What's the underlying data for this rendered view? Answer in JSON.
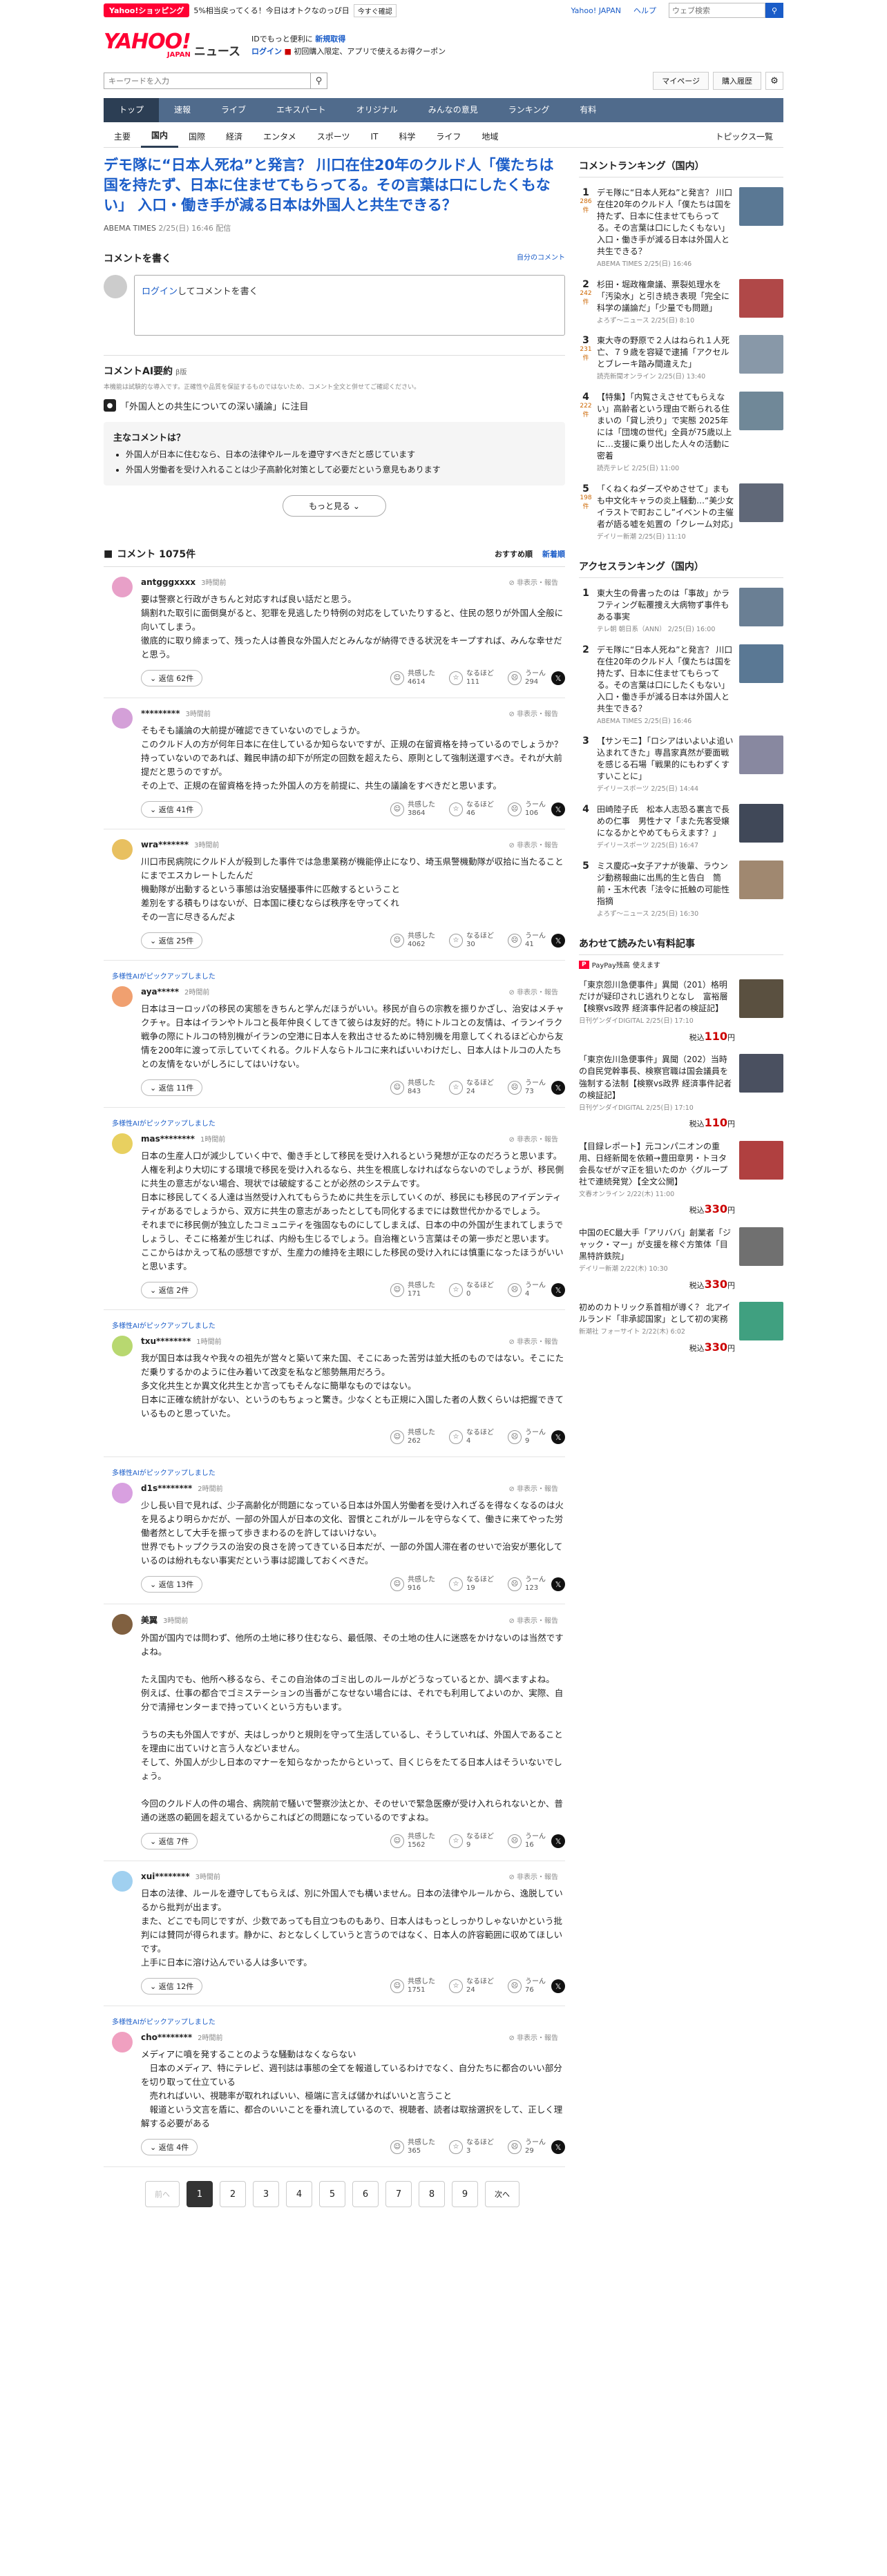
{
  "topbar": {
    "shop": "Yahoo!ショッピング",
    "promo": "5%相当戻ってくる！今日はオトクなのっぴ日",
    "promo_badge": "今すぐ確認",
    "links": [
      "Yahoo! JAPAN",
      "ヘルプ"
    ],
    "search_placeholder": "ウェブ検索"
  },
  "header": {
    "logo": "YAHOO!",
    "logo_sub": "JAPAN",
    "service": "ニュース",
    "promo_line1_pre": "IDでもっと便利に",
    "promo_line1_link": "新規取得",
    "promo_line2_link": "ログイン",
    "promo_line2_post": "初回購入限定、アプリで使えるお得クーポン"
  },
  "search": {
    "placeholder": "キーワードを入力",
    "mypage": "マイページ",
    "history": "購入履歴"
  },
  "nav": [
    "トップ",
    "速報",
    "ライブ",
    "エキスパート",
    "オリジナル",
    "みんなの意見",
    "ランキング",
    "有料"
  ],
  "subnav": [
    "主要",
    "国内",
    "国際",
    "経済",
    "エンタメ",
    "スポーツ",
    "IT",
    "科学",
    "ライフ",
    "地域"
  ],
  "subnav_more": "トピックス一覧",
  "article": {
    "title": "デモ隊に“日本人死ね”と発言？ 川口在住20年のクルド人「僕たちは国を持たず、日本に住ませてもらってる。その言葉は口にしたくもない」 入口・働き手が減る日本は外国人と共生できる？",
    "source": "ABEMA TIMES",
    "time": "2/25(日) 16:46 配信"
  },
  "comment_form": {
    "heading": "コメントを書く",
    "link": "自分のコメント",
    "login": "ログイン",
    "prompt": "してコメントを書く"
  },
  "ai": {
    "heading": "コメントAI要約",
    "beta": "β版",
    "note": "本機能は試験的な導入です。正確性や品質を保証するものではないため、コメント全文と併せてご確認ください。",
    "topic": "「外国人との共生についての深い議論」に注目",
    "main_title": "主なコメントは？",
    "points": [
      "外国人が日本に住むなら、日本の法律やルールを遵守すべきだと感じています",
      "外国人労働者を受け入れることは少子高齢化対策として必要だという意見もあります"
    ],
    "more": "もっと見る"
  },
  "comments_header": {
    "title": "コメント 1075件",
    "sort_recommended": "おすすめ順",
    "sort_new": "新着順"
  },
  "comment_labels": {
    "flag": "非表示・報告",
    "pick": "多様性AIがピックアップしました",
    "r1": "共感した",
    "r2": "なるほど",
    "r3": "うーん"
  },
  "comments": [
    {
      "user": "antgggxxxx",
      "ago": "3時間前",
      "pick": false,
      "color": "#e8a0c8",
      "text": "要は警察と行政がきちんと対応すれば良い話だと思う。\n鍋割れた取引に面倒臭がると、犯罪を見逃したり特例の対応をしていたりすると、住民の怒りが外国人全般に向いてしまう。\n徹底的に取り締まって、残った人は善良な外国人だとみんなが納得できる状況をキープすれば、みんな幸せだと思う。",
      "replies": "返信 62件",
      "r1": "4614",
      "r2": "111",
      "r3": "294"
    },
    {
      "user": "*********",
      "ago": "3時間前",
      "pick": false,
      "color": "#d4a0d8",
      "text": "そもそも議論の大前提が確認できていないのでしょうか。\nこのクルド人の方が何年日本に在住しているか知らないですが、正規の在留資格を持っているのでしょうか？\n持っていないのであれば、難民申請の却下が所定の回数を超えたら、原則として強制送還すべき。それが大前提だと思うのですが。\nその上で、正規の在留資格を持った外国人の方を前提に、共生の議論をすべきだと思います。",
      "replies": "返信 41件",
      "r1": "3864",
      "r2": "46",
      "r3": "106"
    },
    {
      "user": "wra*******",
      "ago": "3時間前",
      "pick": false,
      "color": "#e8c060",
      "text": "川口市民病院にクルド人が殺到した事件では急患業務が機能停止になり、埼玉県警機動隊が収拾に当たることにまでエスカレートしたんだ\n機動隊が出動するという事態は治安騒擾事件に匹敵するということ\n差別をする積もりはないが、日本国に棲むならば秩序を守ってくれ\nその一言に尽きるんだよ",
      "replies": "返信 25件",
      "r1": "4062",
      "r2": "30",
      "r3": "41"
    },
    {
      "user": "aya*****",
      "ago": "2時間前",
      "pick": true,
      "color": "#f0a070",
      "text": "日本はヨーロッパの移民の実態をきちんと学んだほうがいい。移民が自らの宗教を振りかざし、治安はメチャクチャ。日本はイランやトルコと長年仲良くしてきて彼らは友好的だ。特にトルコとの友情は、イランイラク戦争の際にトルコの特別機がイランの空港に日本人を救出させるために特別機を用意してくれるほど心から友情を200年に渡って示していてくれる。クルド人ならトルコに来ればいいわけだし、日本人はトルコの人たちとの友情をないがしろにしてはいけない。",
      "replies": "返信 11件",
      "r1": "843",
      "r2": "24",
      "r3": "73"
    },
    {
      "user": "mas********",
      "ago": "1時間前",
      "pick": true,
      "color": "#e8d060",
      "text": "日本の生産人口が減少していく中で、働き手として移民を受け入れるという発想が正なのだろうと思います。人権を利より大切にする環境で移民を受け入れるなら、共生を根底しなければならないのでしょうが、移民側に共生の意志がない場合、現状では破綻することが必然のシステムです。\n日本に移民してくる人達は当然受け入れてもらうために共生を示していくのが、移民にも移民のアイデンティティがあるでしょうから、双方に共生の意志があったとしても同化するまでには数世代かかるでしょう。\nそれまでに移民側が独立したコミュニティを強固なものにしてしまえば、日本の中の外国が生まれてしまうでしょうし、そこに格差が生じれば、内紛も生じるでしょう。自治権という言葉はその第一歩だと思います。\nここからはかえって私の感想ですが、生産力の維持を主眼にした移民の受け入れには慎重になったほうがいいと思います。",
      "replies": "返信 2件",
      "r1": "171",
      "r2": "0",
      "r3": "4"
    },
    {
      "user": "txu********",
      "ago": "1時間前",
      "pick": true,
      "color": "#b8d870",
      "text": "我が国日本は我々や我々の祖先が営々と築いて来た国、そこにあった苦労は並大抵のものではない。そこにただ乗りするかのように住み着いて改変を私など態勢無用だろう。\n多文化共生とか異文化共生とか言ってもそんなに簡単なものではない。\n日本に正確な統計がない、というのもちょっと驚き。少なくとも正規に入国した者の人数くらいは把握できているものと思っていた。",
      "replies": "",
      "r1": "262",
      "r2": "4",
      "r3": "9"
    },
    {
      "user": "d1s********",
      "ago": "2時間前",
      "pick": true,
      "color": "#d8a0e0",
      "text": "少し長い目で見れば、少子高齢化が問題になっている日本は外国人労働者を受け入れざるを得なくなるのは火を見るより明らかだが、一部の外国人が日本の文化、習慣とこれがルールを守らなくて、働きに来てやった労働者然として大手を振って歩きまわるのを許してはいけない。\n世界でもトップクラスの治安の良さを誇ってきている日本だが、一部の外国人滞在者のせいで治安が悪化しているのは紛れもない事実だという事は認識しておくべきだ。",
      "replies": "返信 13件",
      "r1": "916",
      "r2": "19",
      "r3": "123"
    },
    {
      "user": "美翼",
      "ago": "3時間前",
      "pick": false,
      "color": "#806040",
      "text": "外国が国内では問わず、他所の土地に移り住むなら、最低限、その土地の住人に迷惑をかけないのは当然ですよね。\n\nたえ国内でも、他所へ移るなら、そこの自治体のゴミ出しのルールがどうなっているとか、調べますよね。\n例えば、仕事の都合でゴミステーションの当番がこなせない場合には、それでも利用してよいのか、実際、自分で清掃センターまで持っていくという方もいます。\n\nうちの夫も外国人ですが、夫はしっかりと規則を守って生活しているし、そうしていれば、外国人であることを理由に出ていけと言う人などいません。\nそして、外国人が少し日本のマナーを知らなかったからといって、目くじらをたてる日本人はそういないでしょう。\n\n今回のクルド人の件の場合、病院前で騒いで警察沙汰とか、そのせいで緊急医療が受け入れられないとか、普通の迷惑の範囲を超えているからこればどの問題になっているのですよね。",
      "replies": "返信 7件",
      "r1": "1562",
      "r2": "9",
      "r3": "16"
    },
    {
      "user": "xui********",
      "ago": "3時間前",
      "pick": false,
      "color": "#a0d0f0",
      "text": "日本の法律、ルールを遵守してもらえば、別に外国人でも構いません。日本の法律やルールから、逸脱しているから批判が出ます。\nまた、どこでも同じですが、少数であっても目立つものもあり、日本人はもっとしっかりしゃないかという批判には賛同が得られます。静かに、おとなしくしていうと言うのではなく、日本人の許容範囲に収めてほしいです。\n上手に日本に溶け込んでいる人は多いです。",
      "replies": "返信 12件",
      "r1": "1751",
      "r2": "24",
      "r3": "76"
    },
    {
      "user": "cho********",
      "ago": "2時間前",
      "pick": true,
      "color": "#f0a0c0",
      "text": "メディアに噴を発することのような騒動はなくならない\n　日本のメディア、特にテレビ、週刊誌は事態の全てを報道しているわけでなく、自分たちに都合のいい部分を切り取って仕立ている\n　売れればいい、視聴率が取れればいい、極端に言えば儲かればいいと言うこと\n　報道という文言を盾に、都合のいいことを垂れ流しているので、視聴者、読者は取捨選択をして、正しく理解する必要がある",
      "replies": "返信 4件",
      "r1": "365",
      "r2": "3",
      "r3": "29"
    }
  ],
  "pager": {
    "prev": "前へ",
    "pages": [
      "1",
      "2",
      "3",
      "4",
      "5",
      "6",
      "7",
      "8",
      "9"
    ],
    "next": "次へ"
  },
  "side": {
    "ranking_title": "コメントランキング（国内）",
    "ranking": [
      {
        "rank": "1",
        "count": "286",
        "unit": "件",
        "title": "デモ隊に“日本人死ね”と発言？ 川口在住20年のクルド人「僕たちは国を持たず、日本に住ませてもらってる。その言葉は口にしたくもない」 入口・働き手が減る日本は外国人と共生できる？",
        "meta": "ABEMA TIMES 2/25(日) 16:46",
        "color": "#5a7894"
      },
      {
        "rank": "2",
        "count": "242",
        "unit": "件",
        "title": "杉田・堀政権衆議、票裂処理水を「汚染水」と引き続き表現「完全に科学の議論だ」「少量でも問題」",
        "meta": "よろず〜ニュース 2/25(日) 8:10",
        "color": "#b04848"
      },
      {
        "rank": "3",
        "count": "231",
        "unit": "件",
        "title": "東大寺の野原で２人はねられ１人死亡、７９歳を容疑で逮捕「アクセルとブレーキ踏み間違えた」",
        "meta": "読売新聞オンライン 2/25(日) 13:40",
        "color": "#8898a8"
      },
      {
        "rank": "4",
        "count": "222",
        "unit": "件",
        "title": "【特集】「内覧さえさせてもらえない」高齢者という理由で断られる住まいの「貸し渋り」で実態 2025年には「団塊の世代」全員が75歳以上に…支援に乗り出した人々の活動に密着",
        "meta": "読売テレビ 2/25(日) 11:00",
        "color": "#708898"
      },
      {
        "rank": "5",
        "count": "198",
        "unit": "件",
        "title": "「くねくねダーズやめさせて」まもも中文化キャラの炎上騒動…“美少女イラストで町おこし”イベントの主催者が語る嘘を処置の「クレーム対応」",
        "meta": "デイリー新潮 2/25(日) 11:10",
        "color": "#606878"
      }
    ],
    "access_title": "アクセスランキング（国内）",
    "access": [
      {
        "rank": "1",
        "title": "東大生の骨書ったのは「事故」かラフティング転覆捜え大病物ず事件もある事実",
        "meta": "テレ朝 朝日系（ANN） 2/25(日) 16:00",
        "color": "#6a7f94"
      },
      {
        "rank": "2",
        "title": "デモ隊に“日本人死ね”と発言？ 川口在住20年のクルド人「僕たちは国を持たず、日本に住ませてもらってる。その言葉は口にしたくもない」 入口・働き手が減る日本は外国人と共生できる？",
        "meta": "ABEMA TIMES 2/25(日) 16:46",
        "color": "#5a7894"
      },
      {
        "rank": "3",
        "title": "【サンモニ】「ロシアはいよいよ追い込まれてきた」専昌家真然が要面戦を感じる石場「戦果的にもわずくすすいことに」",
        "meta": "デイリースポーツ 2/25(日) 14:44",
        "color": "#8888a0"
      },
      {
        "rank": "4",
        "title": "田崎陸子氏　松本人志恐る裏言で長めの仁事　男性ナマ「また先客受嬢になるかとやめてもらえます？」",
        "meta": "デイリースポーツ 2/25(日) 16:47",
        "color": "#404858"
      },
      {
        "rank": "5",
        "title": "ミス慶応→女子アナが後輩、ラウンジ動務報曲に出馬的生と告白　筒前・玉木代表「法令に抵触の可能性指摘",
        "meta": "よろず〜ニュース 2/25(日) 16:30",
        "color": "#a08870"
      }
    ],
    "paid_title": "あわせて読みたい有料記事",
    "paypay": "PayPay残高",
    "paypay_note": "使えます",
    "paid": [
      {
        "title": "「東京怨川急便事件」異聞（201）格明だけが疑印されじ逃れりとなし　富裕層【検察vs政界 経済事件記者の検証記】",
        "meta": "日刊ゲンダイDIGITAL 2/25(日) 17:10",
        "price_pre": "税込",
        "price": "110",
        "price_unit": "円",
        "color": "#5a5040"
      },
      {
        "title": "「東京佐川急便事件」異聞（202）当時の自民党幹事長、検察官職は国会議員を強制する法制【検察vs政界 経済事件記者の検証記】",
        "meta": "日刊ゲンダイDIGITAL 2/25(日) 17:10",
        "price_pre": "税込",
        "price": "110",
        "price_unit": "円",
        "color": "#4a5060"
      },
      {
        "title": "【目録レポート】元コンパニオンの重用、日経新聞を依頼→豊田章男・トヨタ会長なぜがマ正を狙いたのか〈グループ社で連続発覚〉【全文公開】",
        "meta": "文春オンライン 2/22(木) 11:00",
        "price_pre": "税込",
        "price": "330",
        "price_unit": "円",
        "color": "#b04040"
      },
      {
        "title": "中国のEC最大手「アリババ」創業者「ジャック・マー」が支援を稼ぐ方策体「目黒特許鉄院」",
        "meta": "デイリー新潮 2/22(木) 10:30",
        "price_pre": "税込",
        "price": "330",
        "price_unit": "円",
        "color": "#707070"
      },
      {
        "title": "初めのカトリック系首相が導く？ 北アイルランド「非承認国家」として初の実務",
        "meta": "新潮社 フォーサイト 2/22(木) 6:02",
        "price_pre": "税込",
        "price": "330",
        "price_unit": "円",
        "color": "#40a080"
      }
    ]
  }
}
